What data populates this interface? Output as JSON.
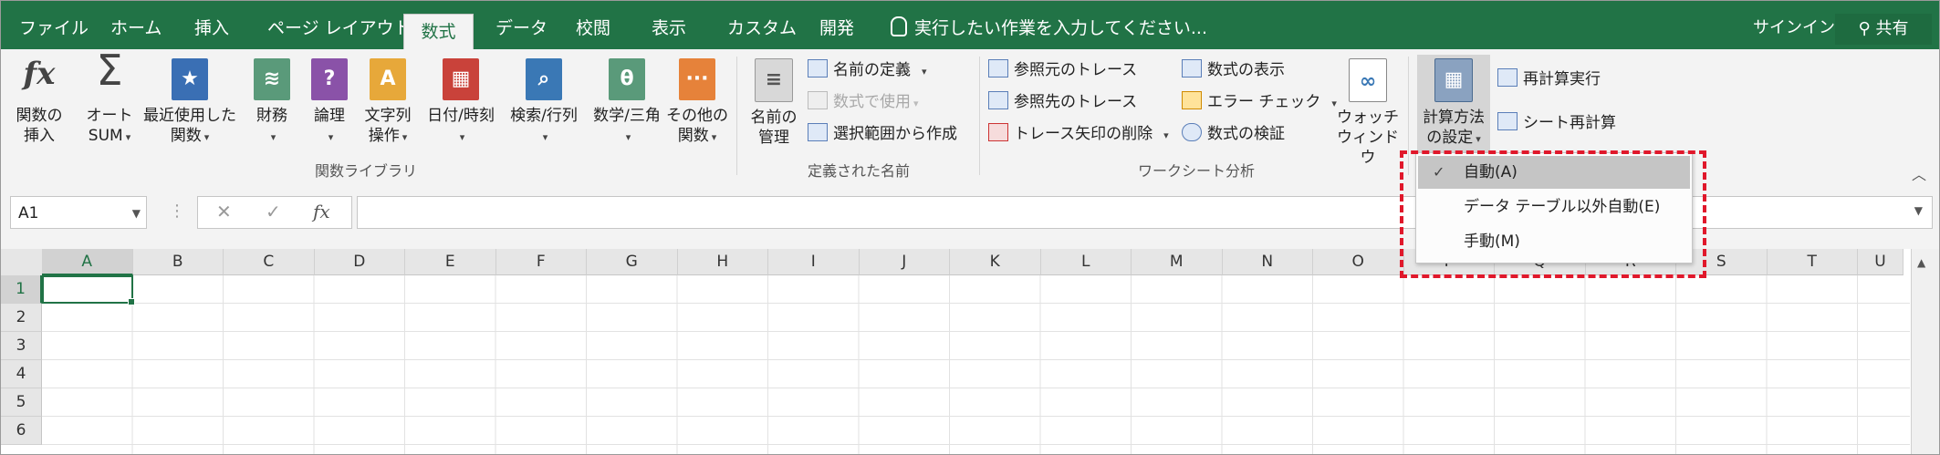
{
  "tabs": [
    {
      "label": "ファイル"
    },
    {
      "label": "ホーム"
    },
    {
      "label": "挿入"
    },
    {
      "label": "ページ レイアウト"
    },
    {
      "label": "数式"
    },
    {
      "label": "データ"
    },
    {
      "label": "校閲"
    },
    {
      "label": "表示"
    },
    {
      "label": "カスタム"
    },
    {
      "label": "開発"
    }
  ],
  "tell_me": "実行したい作業を入力してください...",
  "sign_in": "サインイン",
  "share": "共有",
  "ribbon": {
    "function_library": {
      "group_label": "関数ライブラリ",
      "insert_function": [
        "関数の",
        "挿入"
      ],
      "autosum": [
        "オート",
        "SUM"
      ],
      "recent": [
        "最近使用した",
        "関数"
      ],
      "financial": "財務",
      "logical": "論理",
      "text": [
        "文字列",
        "操作"
      ],
      "datetime": "日付/時刻",
      "lookup": "検索/行列",
      "math": "数学/三角",
      "more": [
        "その他の",
        "関数"
      ]
    },
    "defined_names": {
      "group_label": "定義された名前",
      "name_manager": [
        "名前の",
        "管理"
      ],
      "define_name": "名前の定義",
      "use_in_formula": "数式で使用",
      "create_from_selection": "選択範囲から作成"
    },
    "formula_auditing": {
      "group_label": "ワークシート分析",
      "trace_precedents": "参照元のトレース",
      "trace_dependents": "参照先のトレース",
      "remove_arrows": "トレース矢印の削除",
      "show_formulas": "数式の表示",
      "error_checking": "エラー チェック",
      "evaluate_formula": "数式の検証",
      "watch_window": [
        "ウォッチ",
        "ウィンドウ"
      ]
    },
    "calculation": {
      "calc_options": [
        "計算方法",
        "の設定"
      ],
      "calc_now": "再計算実行",
      "calc_sheet": "シート再計算"
    }
  },
  "formula_bar": {
    "name_box": "A1",
    "cancel": "✕",
    "enter": "✓",
    "fx": "fx"
  },
  "columns": [
    "A",
    "B",
    "C",
    "D",
    "E",
    "F",
    "G",
    "H",
    "I",
    "J",
    "K",
    "L",
    "M",
    "N",
    "O",
    "P",
    "Q",
    "R",
    "S",
    "T",
    "U"
  ],
  "rows": [
    "1",
    "2",
    "3",
    "4",
    "5",
    "6"
  ],
  "calc_menu": {
    "items": [
      {
        "label": "自動(A)",
        "checked": true
      },
      {
        "label": "データ テーブル以外自動(E)",
        "checked": false
      },
      {
        "label": "手動(M)",
        "checked": false
      }
    ]
  },
  "colors": {
    "excel_green": "#217346",
    "highlight_red": "#e0182b"
  }
}
